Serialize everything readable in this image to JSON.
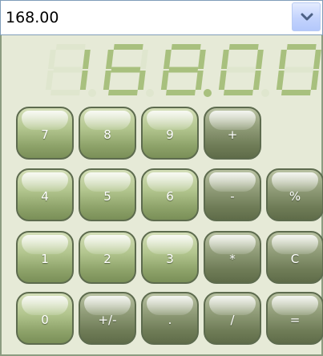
{
  "combo": {
    "value": "168.00",
    "dropdown_icon": "chevron-down-icon"
  },
  "display": {
    "value": "168.00",
    "lit_color": "#a8c07e",
    "unlit_color": "#dfe6ce"
  },
  "keypad": {
    "k7": "7",
    "k8": "8",
    "k9": "9",
    "plus": "+",
    "k4": "4",
    "k5": "5",
    "k6": "6",
    "minus": "-",
    "percent": "%",
    "k1": "1",
    "k2": "2",
    "k3": "3",
    "multiply": "*",
    "clear": "C",
    "k0": "0",
    "plus_minus": "+/-",
    "decimal": ".",
    "divide": "/",
    "equals": "="
  },
  "colors": {
    "digit_key": "#a9bd84",
    "operator_key": "#859170",
    "panel_background": "#e6ead7"
  }
}
